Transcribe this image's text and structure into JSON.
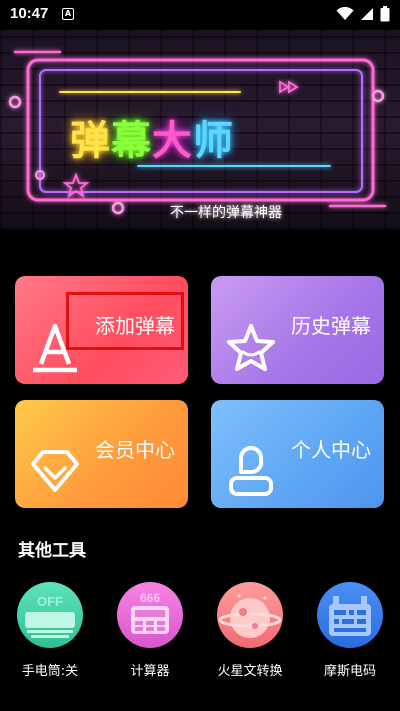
{
  "status": {
    "time": "10:47",
    "notif": "A"
  },
  "banner": {
    "title_chars": [
      "弹",
      "幕",
      "大",
      "师"
    ],
    "subtitle": "不一样的弹幕神器"
  },
  "cards": [
    {
      "label": "添加弹幕",
      "icon": "letter-a-icon"
    },
    {
      "label": "历史弹幕",
      "icon": "star-icon"
    },
    {
      "label": "会员中心",
      "icon": "diamond-icon"
    },
    {
      "label": "个人中心",
      "icon": "person-icon"
    }
  ],
  "section": {
    "title": "其他工具"
  },
  "tools": [
    {
      "label": "手电筒:关",
      "badge": "OFF",
      "color": "#3fd3a6",
      "icon": "flashlight-icon"
    },
    {
      "label": "计算器",
      "badge": "666",
      "color": "#f06bd8",
      "icon": "calculator-icon"
    },
    {
      "label": "火星文转换",
      "badge": "",
      "color": "#ff8a8a",
      "icon": "planet-icon"
    },
    {
      "label": "摩斯电码",
      "badge": "",
      "color": "#3d82f0",
      "icon": "morse-code-icon"
    }
  ],
  "colors": {
    "highlight": "#dd1111"
  }
}
